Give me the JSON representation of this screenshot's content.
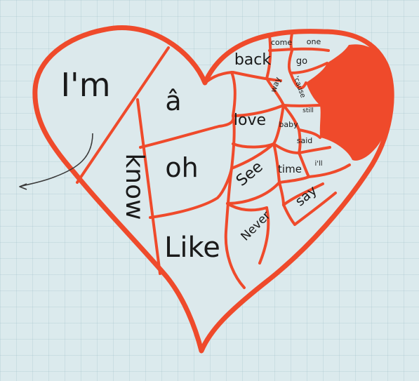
{
  "board": {
    "colors": {
      "heart_stroke": "#ef4a2b",
      "heart_fill": "#dce9ec",
      "filled_region": "#ef4a2b",
      "text": "#1a1a1a",
      "arrow": "#3a3a3a"
    }
  },
  "words": {
    "im": "I'm",
    "know": "know",
    "a_circ": "â",
    "oh": "oh",
    "like": "Like",
    "back": "back",
    "come": "come",
    "one": "one",
    "go": "go",
    "way": "way",
    "cause": "'cause",
    "love": "love",
    "baby": "baby",
    "still": "still",
    "said": "said",
    "see": "See",
    "time": "time",
    "ill": "i'll",
    "say": "say",
    "never": "Never"
  }
}
